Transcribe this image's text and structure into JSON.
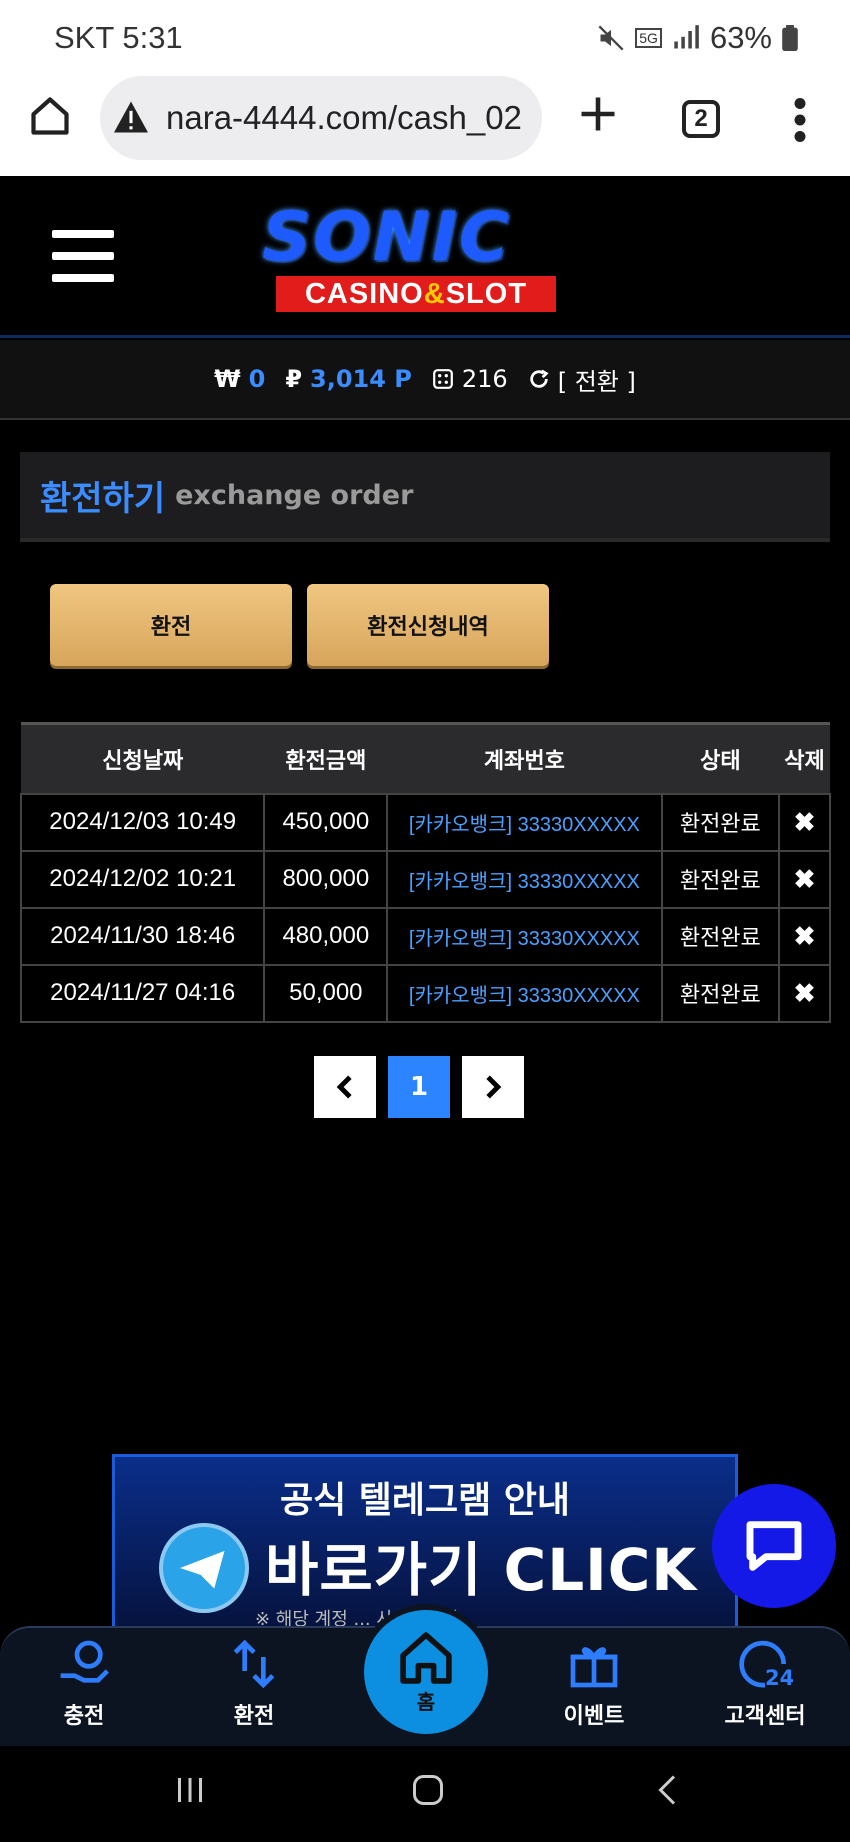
{
  "status_bar": {
    "carrier_time": "SKT 5:31",
    "battery": "63%",
    "network": "5G"
  },
  "browser": {
    "url": "nara-4444.com/cash_02",
    "tab_count": "2"
  },
  "site": {
    "logo_main": "SONIC",
    "logo_sub_left": "CASINO",
    "logo_sub_amp": "&",
    "logo_sub_right": "SLOT"
  },
  "wallet": {
    "won": "0",
    "points": "3,014 P",
    "chips": "216",
    "convert_label": "[ 전환 ]"
  },
  "section": {
    "title_ko": "환전하기",
    "title_en": "exchange order"
  },
  "buttons": {
    "exchange": "환전",
    "history": "환전신청내역"
  },
  "table": {
    "headers": [
      "신청날짜",
      "환전금액",
      "계좌번호",
      "상태",
      "삭제"
    ],
    "rows": [
      {
        "date": "2024/12/03 10:49",
        "amount": "450,000",
        "account": "[카카오뱅크] 33330XXXXX",
        "status": "환전완료",
        "delete": "✖"
      },
      {
        "date": "2024/12/02 10:21",
        "amount": "800,000",
        "account": "[카카오뱅크] 33330XXXXX",
        "status": "환전완료",
        "delete": "✖"
      },
      {
        "date": "2024/11/30 18:46",
        "amount": "480,000",
        "account": "[카카오뱅크] 33330XXXXX",
        "status": "환전완료",
        "delete": "✖"
      },
      {
        "date": "2024/11/27 04:16",
        "amount": "50,000",
        "account": "[카카오뱅크] 33330XXXXX",
        "status": "환전완료",
        "delete": "✖"
      }
    ]
  },
  "pagination": {
    "prev": "‹",
    "current": "1",
    "next": "›"
  },
  "banner": {
    "title": "공식 텔레그램 안내",
    "cta": "바로가기 CLICK",
    "note": "※ 해당 계정 ... 사칭입니다"
  },
  "bottom_nav": {
    "charge": "충전",
    "exchange": "환전",
    "home": "홈",
    "event": "이벤트",
    "support": "고객센터"
  },
  "colors": {
    "accent_blue": "#3b8cff",
    "gold": "#e5b56e",
    "background": "#000000"
  }
}
